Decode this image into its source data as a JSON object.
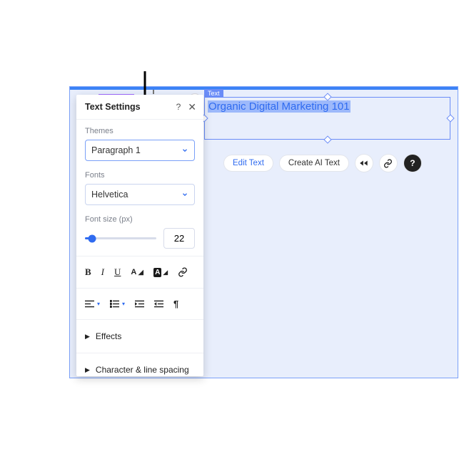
{
  "canvas": {
    "text_box": {
      "tag": "Text",
      "content": "Organic Digital Marketing 101"
    },
    "actions": {
      "edit_text": "Edit Text",
      "create_ai_text": "Create AI Text"
    }
  },
  "panel": {
    "title": "Text Settings",
    "themes": {
      "label": "Themes",
      "value": "Paragraph 1"
    },
    "fonts": {
      "label": "Fonts",
      "value": "Helvetica"
    },
    "font_size": {
      "label": "Font size (px)",
      "value": "22"
    },
    "effects_label": "Effects",
    "char_spacing_label": "Character & line spacing"
  }
}
